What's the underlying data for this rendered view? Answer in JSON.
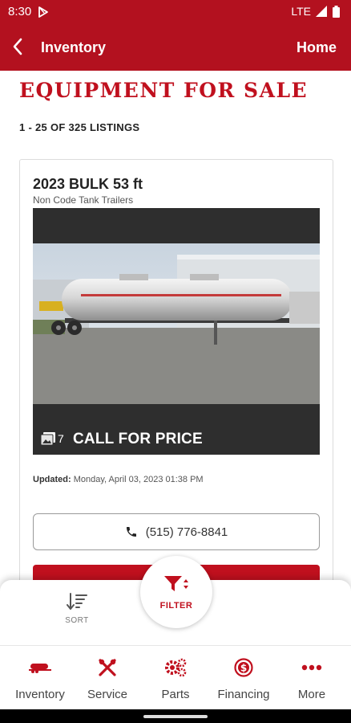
{
  "status_bar": {
    "time": "8:30",
    "network": "LTE"
  },
  "app_bar": {
    "title": "Inventory",
    "home_label": "Home"
  },
  "page": {
    "title": "EQUIPMENT FOR SALE",
    "listings_count": "1 - 25 OF 325 LISTINGS"
  },
  "listing": {
    "title": "2023 BULK 53 ft",
    "category": "Non Code Tank Trailers",
    "photo_count": "7",
    "price": "CALL FOR PRICE",
    "updated_label": "Updated:",
    "updated_value": "Monday, April 03, 2023 01:38 PM",
    "phone": "(515) 776-8841"
  },
  "filter_bar": {
    "sort_label": "SORT",
    "filter_label": "FILTER"
  },
  "bottom_nav": {
    "items": [
      {
        "label": "Inventory",
        "icon": "tank-trailer-icon"
      },
      {
        "label": "Service",
        "icon": "tools-icon"
      },
      {
        "label": "Parts",
        "icon": "gears-icon"
      },
      {
        "label": "Financing",
        "icon": "dollar-coin-icon"
      },
      {
        "label": "More",
        "icon": "more-dots-icon"
      }
    ]
  },
  "colors": {
    "brand_red": "#b3111f",
    "accent_red": "#c0101e"
  }
}
